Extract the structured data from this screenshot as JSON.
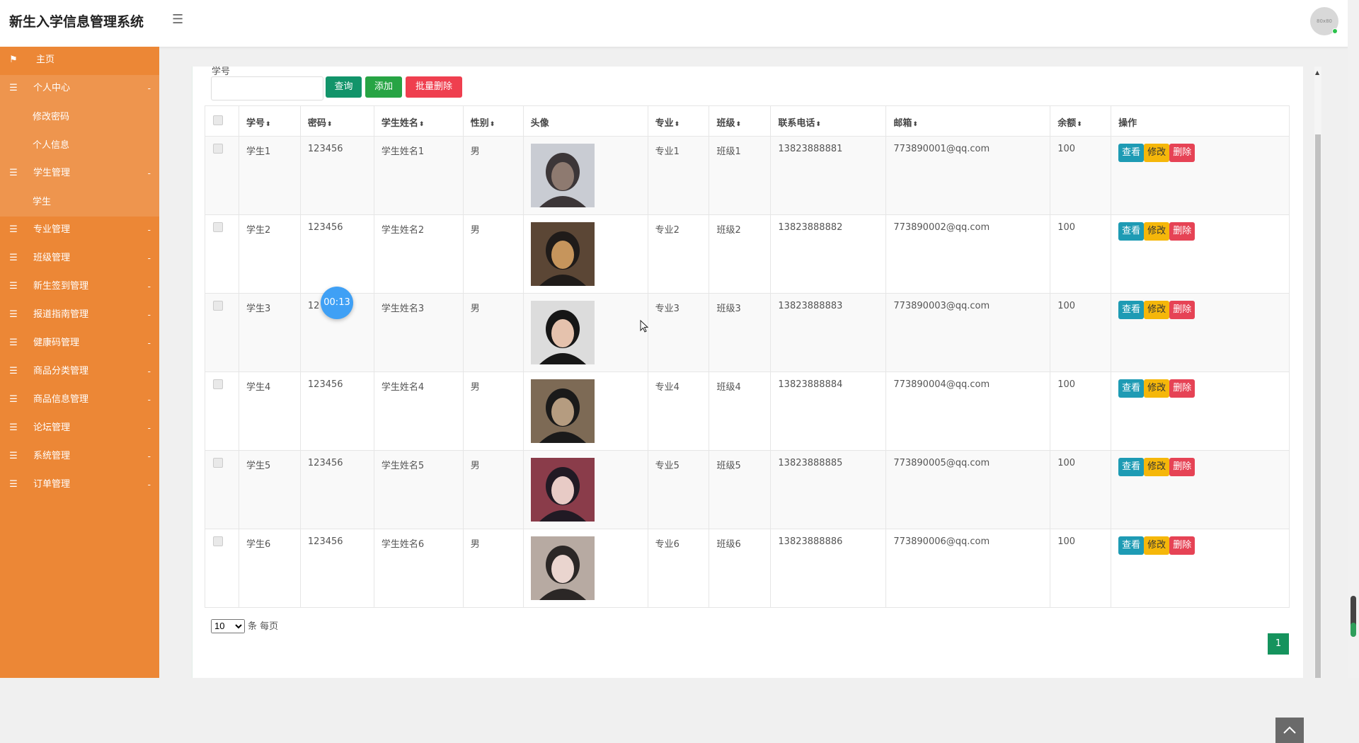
{
  "app": {
    "title": "新生入学信息管理系统",
    "avatar_text": "80x80"
  },
  "sidebar": {
    "home": "主页",
    "groups": [
      {
        "label": "个人中心",
        "chev": "-",
        "subs": [
          "修改密码",
          "个人信息"
        ]
      },
      {
        "label": "学生管理",
        "chev": "-",
        "subs": [
          "学生"
        ]
      },
      {
        "label": "专业管理",
        "chev": "-"
      },
      {
        "label": "班级管理",
        "chev": "-"
      },
      {
        "label": "新生签到管理",
        "chev": "-"
      },
      {
        "label": "报道指南管理",
        "chev": "-"
      },
      {
        "label": "健康码管理",
        "chev": "-"
      },
      {
        "label": "商品分类管理",
        "chev": "-"
      },
      {
        "label": "商品信息管理",
        "chev": "-"
      },
      {
        "label": "论坛管理",
        "chev": "-"
      },
      {
        "label": "系统管理",
        "chev": "-"
      },
      {
        "label": "订单管理",
        "chev": "-"
      }
    ]
  },
  "search": {
    "label": "学号",
    "value": "",
    "query": "查询",
    "add": "添加",
    "batch_delete": "批量删除"
  },
  "table": {
    "headers": [
      "学号",
      "密码",
      "学生姓名",
      "性别",
      "头像",
      "专业",
      "班级",
      "联系电话",
      "邮箱",
      "余额",
      "操作"
    ],
    "sort_glyph": "⬍",
    "rows": [
      {
        "id": "学生1",
        "pwd": "123456",
        "name": "学生姓名1",
        "sex": "男",
        "major": "专业1",
        "cls": "班级1",
        "phone": "13823888881",
        "email": "773890001@qq.com",
        "bal": "100"
      },
      {
        "id": "学生2",
        "pwd": "123456",
        "name": "学生姓名2",
        "sex": "男",
        "major": "专业2",
        "cls": "班级2",
        "phone": "13823888882",
        "email": "773890002@qq.com",
        "bal": "100"
      },
      {
        "id": "学生3",
        "pwd": "12",
        "name": "学生姓名3",
        "sex": "男",
        "major": "专业3",
        "cls": "班级3",
        "phone": "13823888883",
        "email": "773890003@qq.com",
        "bal": "100"
      },
      {
        "id": "学生4",
        "pwd": "123456",
        "name": "学生姓名4",
        "sex": "男",
        "major": "专业4",
        "cls": "班级4",
        "phone": "13823888884",
        "email": "773890004@qq.com",
        "bal": "100"
      },
      {
        "id": "学生5",
        "pwd": "123456",
        "name": "学生姓名5",
        "sex": "男",
        "major": "专业5",
        "cls": "班级5",
        "phone": "13823888885",
        "email": "773890005@qq.com",
        "bal": "100"
      },
      {
        "id": "学生6",
        "pwd": "123456",
        "name": "学生姓名6",
        "sex": "男",
        "major": "专业6",
        "cls": "班级6",
        "phone": "13823888886",
        "email": "773890006@qq.com",
        "bal": "100"
      }
    ],
    "actions": {
      "view": "查看",
      "edit": "修改",
      "del": "删除"
    }
  },
  "pager": {
    "size": "10",
    "size_options": [
      "10"
    ],
    "suffix": "条 每页",
    "page": "1"
  },
  "timer": "00:13",
  "colors": {
    "sidebar": "#ec8736",
    "query": "#12946a",
    "add": "#27a444",
    "danger": "#ef3f4f",
    "view": "#1e9bb4",
    "edit": "#f5b70a"
  }
}
